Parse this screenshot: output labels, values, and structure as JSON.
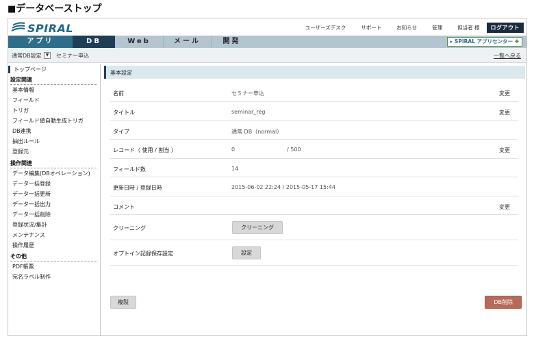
{
  "page": {
    "heading_mark": "■",
    "heading": "データベーストップ"
  },
  "logo": {
    "text": "SPIRAL"
  },
  "toplinks": [
    "ユーザーズデスク",
    "サポート",
    "お知らせ",
    "管理",
    "担当者 様"
  ],
  "logout_label": "ログアウト",
  "nav": {
    "tabs": [
      "アプリ",
      "DB",
      "Web",
      "メール",
      "開発"
    ],
    "active": "DB",
    "app_center": "SPIRAL アプリセンター"
  },
  "subbar": {
    "db_mode": "通常DB設定",
    "db_name": "セミナー申込",
    "back_link": "一覧へ戻る"
  },
  "sidebar": {
    "top": "トップページ",
    "groups": [
      {
        "head": "設定関連",
        "items": [
          "基本情報",
          "フィールド",
          "トリガ",
          "フィールド値自動生成トリガ",
          "DB連携",
          "抽出ルール",
          "登録元"
        ]
      },
      {
        "head": "操作関連",
        "items": [
          "データ編集(DBオペレーション)",
          "データ一括登録",
          "データ一括更新",
          "データ一括出力",
          "データ一括削除",
          "登録状況/集計",
          "メンテナンス",
          "操作履歴"
        ]
      },
      {
        "head": "その他",
        "items": [
          "PDF帳票",
          "宛名ラベル制作"
        ]
      }
    ]
  },
  "main": {
    "section_title": "基本設定",
    "change_label": "変更",
    "rows": [
      {
        "label": "名前",
        "value": "セミナー申込"
      },
      {
        "label": "タイトル",
        "value": "seminar_reg"
      },
      {
        "label": "タイプ",
        "value": "通常 DB（normal）"
      },
      {
        "label": "レコード（ 使用 / 割当 ）",
        "value": "0",
        "value2": "/   500"
      },
      {
        "label": "フィールド数",
        "value": "14"
      },
      {
        "label": "更新日時 / 登録日時",
        "value": "2015-06-02 22:24 / 2015-05-17 15:44"
      },
      {
        "label": "コメント",
        "value": ""
      },
      {
        "label": "クリーニング",
        "button": "クリーニング"
      },
      {
        "label": "オプトイン記録保存設定",
        "button": "設定"
      }
    ],
    "duplicate_label": "複製",
    "delete_label": "DB削除"
  }
}
